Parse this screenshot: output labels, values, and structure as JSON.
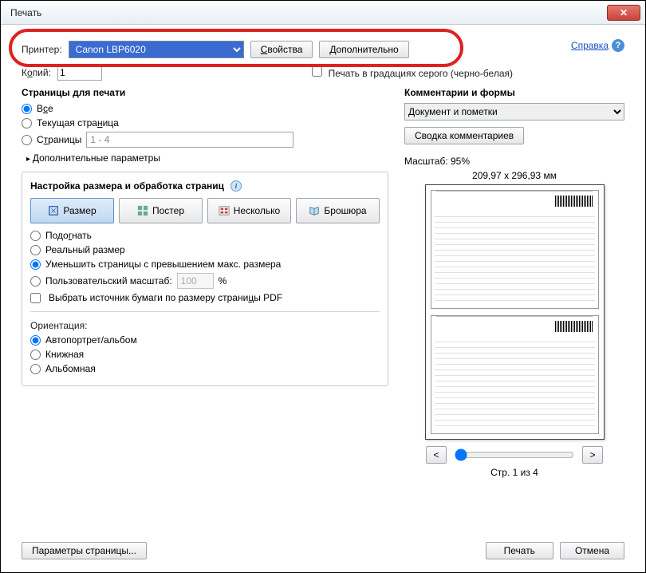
{
  "window": {
    "title": "Печать"
  },
  "topright": {
    "help": "Справка"
  },
  "printer": {
    "label": "Принтер:",
    "selected": "Canon LBP6020",
    "properties": "Свойства",
    "advanced": "Дополнительно"
  },
  "copies": {
    "label_pre": "К",
    "label_u": "о",
    "label_post": "пий:",
    "value": "1",
    "grayscale": "Печать в градациях серого (черно-белая)"
  },
  "pages": {
    "title": "Страницы для печати",
    "all_pre": "В",
    "all_u": "с",
    "all_post": "е",
    "current": "Текущая стра",
    "current_u": "н",
    "current_post": "ица",
    "range_pre": "С",
    "range_u": "т",
    "range_post": "раницы",
    "range_value": "1 - 4",
    "more": "Дополнительные параметры"
  },
  "sizing": {
    "title": "Настройка размера и обработка страниц",
    "size": "Размер",
    "poster": "Постер",
    "multiple": "Несколько",
    "booklet": "Брошюра",
    "fit": "Подо",
    "fit_u": "г",
    "fit_post": "нать",
    "actual": "Реальный размер",
    "shrink": "Уменьшить страницы с превышением макс. размера",
    "custom": "Пользовательский масштаб:",
    "custom_value": "100",
    "percent": "%",
    "source_pre": "Выбрать источник бумаги по размеру страни",
    "source_u": "ц",
    "source_post": "ы PDF"
  },
  "orientation": {
    "title": "Ориентация:",
    "auto": "Автопортрет/альбом",
    "portrait": "Книжная",
    "landscape": "Альбомная"
  },
  "comments": {
    "title": "Комментарии и формы",
    "selected": "Документ и пометки",
    "summary": "Сводка комментариев"
  },
  "preview": {
    "scale_label": "Масштаб: 95%",
    "dims": "209,97 x 296,93 мм",
    "page_of": "Стр. 1 из 4",
    "prev": "<",
    "next": ">"
  },
  "footer": {
    "page_setup": "Параметры страницы...",
    "print": "Печать",
    "cancel": "Отмена"
  }
}
